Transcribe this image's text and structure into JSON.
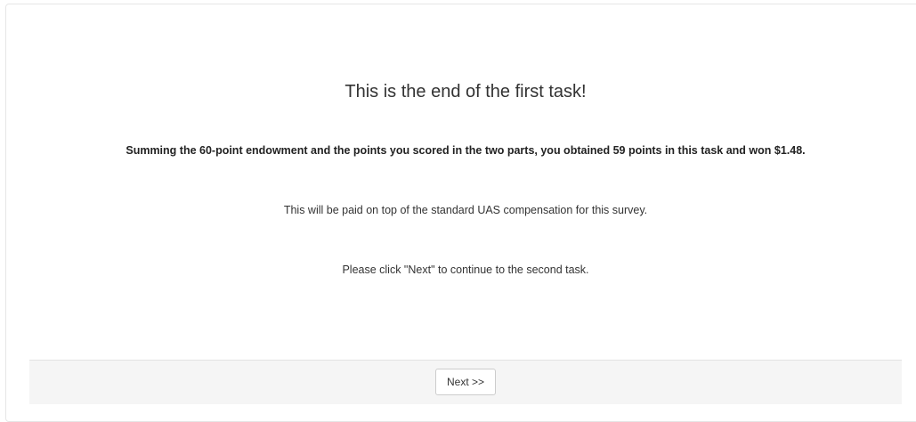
{
  "page": {
    "title": "This is the end of the first task!",
    "summary": "Summing the 60-point endowment and the points you scored in the two parts, you obtained 59 points in this task and won $1.48.",
    "payment_note": "This will be paid on top of the standard UAS compensation for this survey.",
    "instruction": "Please click \"Next\" to continue to the second task."
  },
  "footer": {
    "next_label": "Next >>"
  }
}
